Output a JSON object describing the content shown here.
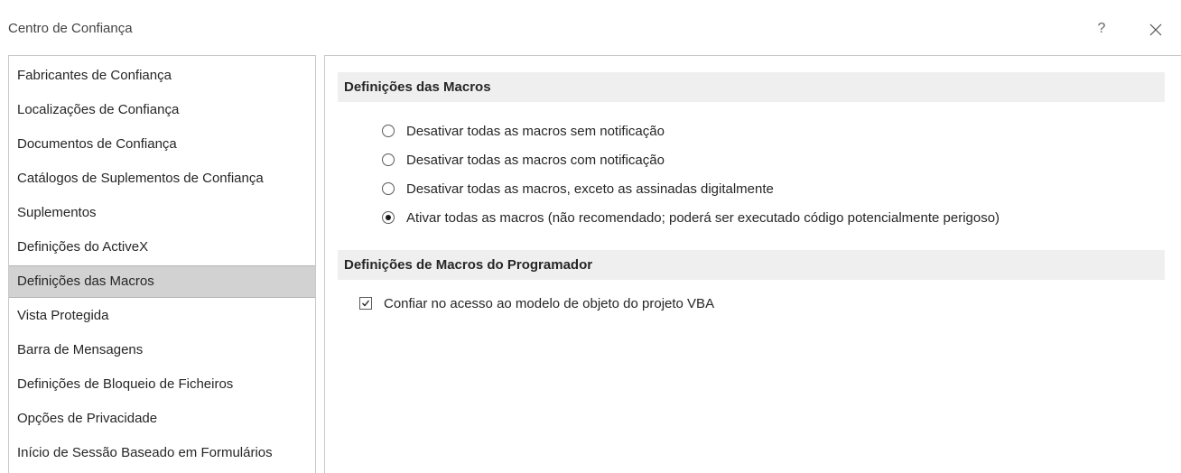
{
  "window": {
    "title": "Centro de Confiança",
    "help_label": "?"
  },
  "sidebar": {
    "items": [
      {
        "label": "Fabricantes de Confiança"
      },
      {
        "label": "Localizações de Confiança"
      },
      {
        "label": "Documentos de Confiança"
      },
      {
        "label": "Catálogos de Suplementos de Confiança"
      },
      {
        "label": "Suplementos"
      },
      {
        "label": "Definições do ActiveX"
      },
      {
        "label": "Definições das Macros",
        "selected": true
      },
      {
        "label": "Vista Protegida"
      },
      {
        "label": "Barra de Mensagens"
      },
      {
        "label": "Definições de Bloqueio de Ficheiros"
      },
      {
        "label": "Opções de Privacidade"
      },
      {
        "label": "Início de Sessão Baseado em Formulários"
      }
    ]
  },
  "macro_settings": {
    "header": "Definições das Macros",
    "options": [
      {
        "label": "Desativar todas as macros sem notificação",
        "checked": false
      },
      {
        "label": "Desativar todas as macros com notificação",
        "checked": false
      },
      {
        "label": "Desativar todas as macros, exceto as assinadas digitalmente",
        "checked": false
      },
      {
        "label": "Ativar todas as macros (não recomendado; poderá ser executado código potencialmente perigoso)",
        "checked": true
      }
    ]
  },
  "developer_settings": {
    "header": "Definições de Macros do Programador",
    "vba_access": {
      "label": "Confiar no acesso ao modelo de objeto do projeto VBA",
      "checked": true
    }
  },
  "colors": {
    "selected_bg": "#d2d2d2",
    "section_header_bg": "#efefef",
    "border": "#c8c8c8"
  }
}
